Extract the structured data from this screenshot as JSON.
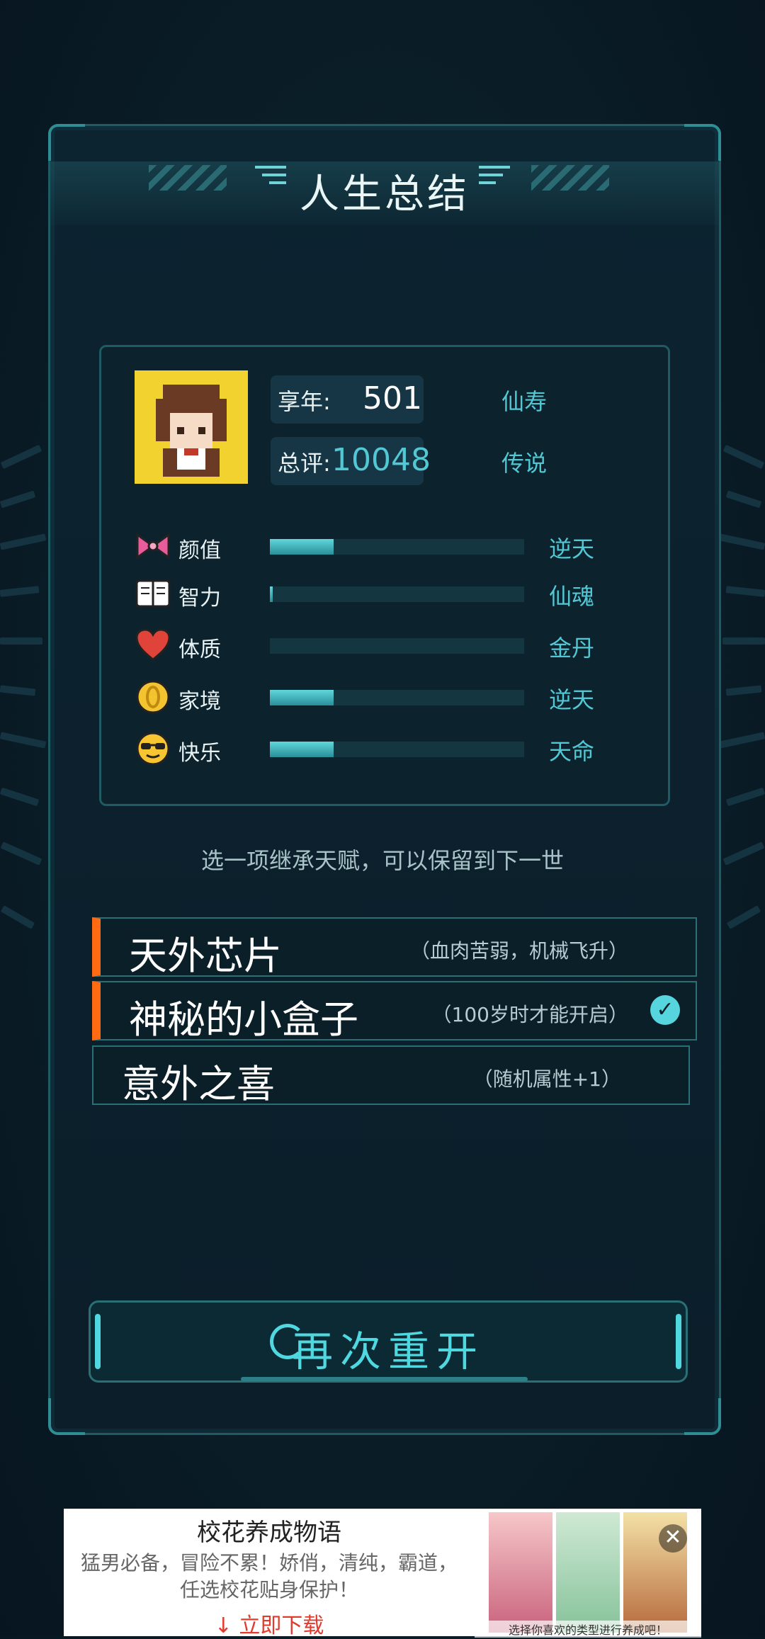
{
  "title": "人生总结",
  "profile": {
    "age_label": "享年:",
    "age_value": "501",
    "age_rank": "仙寿",
    "score_label": "总评:",
    "score_value": "10048",
    "score_rank": "传说"
  },
  "attributes": [
    {
      "label": "颜值",
      "icon": "bow-icon",
      "rank": "逆天",
      "level": 0.25
    },
    {
      "label": "智力",
      "icon": "book-icon",
      "rank": "仙魂",
      "level": 0.01
    },
    {
      "label": "体质",
      "icon": "heart-icon",
      "rank": "金丹",
      "level": 0.0
    },
    {
      "label": "家境",
      "icon": "coin-icon",
      "rank": "逆天",
      "level": 0.25
    },
    {
      "label": "快乐",
      "icon": "sunglasses-face-icon",
      "rank": "天命",
      "level": 0.25
    }
  ],
  "hint": "选一项继承天赋，可以保留到下一世",
  "talents": [
    {
      "name": "天外芯片",
      "desc": "（血肉苦弱，机械飞升）",
      "selected": false
    },
    {
      "name": "神秘的小盒子",
      "desc": "（100岁时才能开启）",
      "selected": true
    },
    {
      "name": "意外之喜",
      "desc": "（随机属性+1）",
      "selected": false
    }
  ],
  "restart_label": "再次重开",
  "ad": {
    "title": "校花养成物语",
    "desc_line1": "猛男必备，冒险不累！娇俏，清纯，霸道，",
    "desc_line2": "任选校花贴身保护！",
    "download": "立即下载",
    "caption": "选择你喜欢的类型进行养成吧！",
    "close": "✕"
  },
  "colors": {
    "accent": "#4fd8e0",
    "rank_text": "#52c8d4",
    "selected_marker": "#ff6a13",
    "background": "#0a1d27"
  }
}
